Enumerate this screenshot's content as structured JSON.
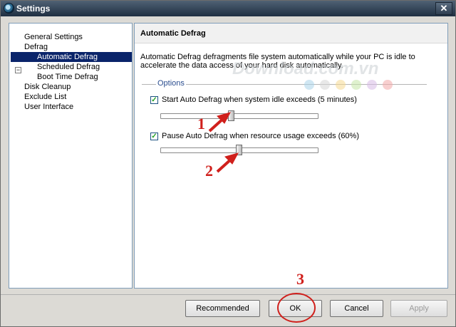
{
  "window": {
    "title": "Settings",
    "close_glyph": "✕"
  },
  "sidebar": {
    "items": [
      {
        "label": "General Settings"
      },
      {
        "label": "Defrag"
      },
      {
        "label": "Automatic Defrag"
      },
      {
        "label": "Scheduled Defrag"
      },
      {
        "label": "Boot Time Defrag"
      },
      {
        "label": "Disk Cleanup"
      },
      {
        "label": "Exclude List"
      },
      {
        "label": "User Interface"
      }
    ],
    "expander_glyph": "−"
  },
  "content": {
    "title": "Automatic Defrag",
    "description": "Automatic Defrag defragments file system automatically while your PC is idle to accelerate the data access of your hard disk automatically.",
    "options_legend": "Options",
    "option1": {
      "label": "Start Auto Defrag when system idle exceeds (5 minutes)",
      "checked": true,
      "check_glyph": "✓",
      "slider_fraction": 0.45
    },
    "option2": {
      "label": "Pause Auto Defrag when resource usage exceeds (60%)",
      "checked": true,
      "check_glyph": "✓",
      "slider_fraction": 0.5
    }
  },
  "watermark": {
    "text": "Download.com.vn",
    "dot_colors": [
      "#a9d3ea",
      "#d6d6d6",
      "#f6d88f",
      "#c5e6a6",
      "#d7b9e6",
      "#f3a8a8"
    ]
  },
  "buttons": {
    "recommended": "Recommended",
    "ok": "OK",
    "cancel": "Cancel",
    "apply": "Apply"
  },
  "annotations": {
    "n1": "1",
    "n2": "2",
    "n3": "3",
    "color": "#d0201c"
  }
}
